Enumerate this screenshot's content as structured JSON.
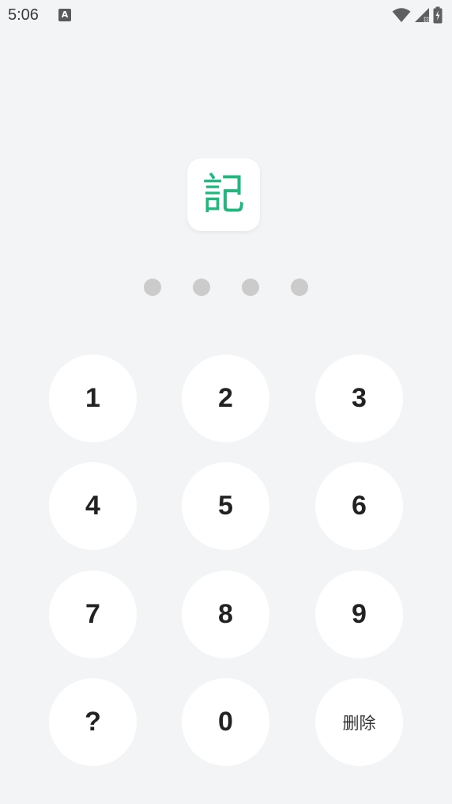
{
  "status_bar": {
    "time": "5:06",
    "notification_icon_letter": "A",
    "icons": [
      "wifi-icon",
      "cellular-signal-icon",
      "battery-charging-icon"
    ]
  },
  "logo": {
    "character": "記",
    "color": "#1fb97f"
  },
  "pin": {
    "length": 4,
    "filled": 0
  },
  "keypad": {
    "keys": [
      "1",
      "2",
      "3",
      "4",
      "5",
      "6",
      "7",
      "8",
      "9",
      "?",
      "0",
      "删除"
    ]
  }
}
